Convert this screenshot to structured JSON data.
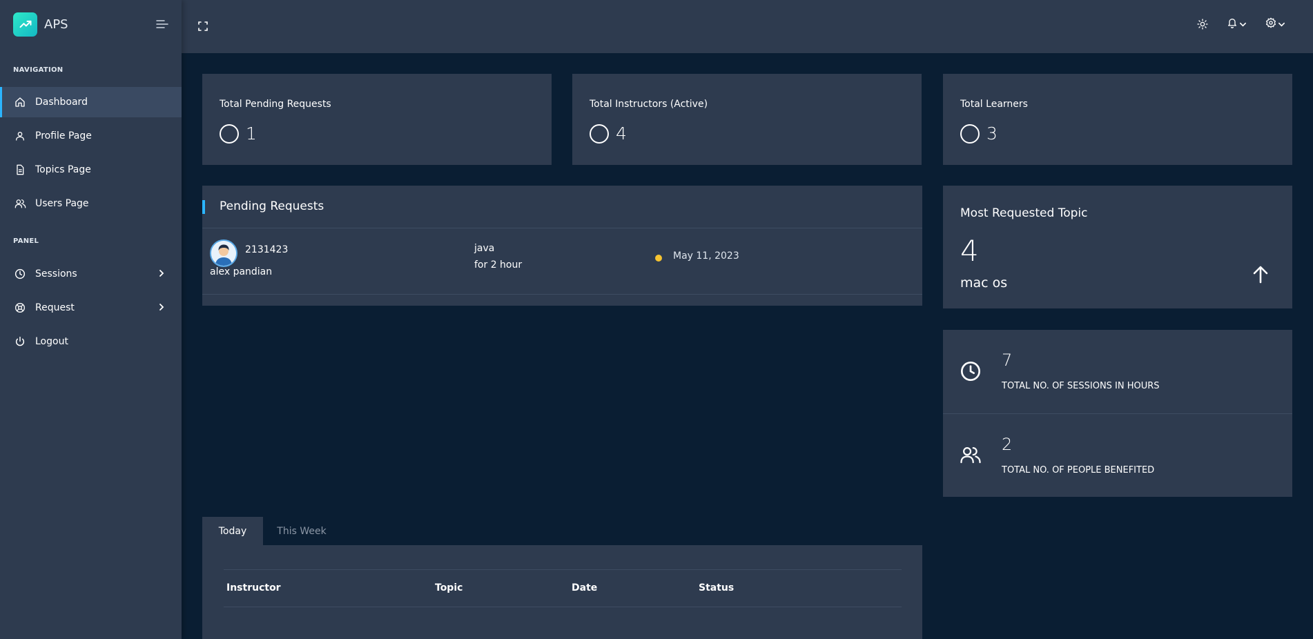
{
  "brand": {
    "name": "APS"
  },
  "sidebar": {
    "nav_heading": "NAVIGATION",
    "panel_heading": "PANEL",
    "nav_items": [
      {
        "label": "Dashboard",
        "icon": "home-icon"
      },
      {
        "label": "Profile Page",
        "icon": "user-icon"
      },
      {
        "label": "Topics Page",
        "icon": "document-icon"
      },
      {
        "label": "Users Page",
        "icon": "users-icon"
      }
    ],
    "panel_items": [
      {
        "label": "Sessions",
        "icon": "clock-icon"
      },
      {
        "label": "Request",
        "icon": "support-icon"
      },
      {
        "label": "Logout",
        "icon": "power-icon"
      }
    ]
  },
  "stats": [
    {
      "title": "Total Pending Requests",
      "value": "1"
    },
    {
      "title": "Total Instructors (Active)",
      "value": "4"
    },
    {
      "title": "Total Learners",
      "value": "3"
    }
  ],
  "pending": {
    "title": "Pending Requests",
    "requests": [
      {
        "id": "2131423",
        "name": "alex pandian",
        "topic": "java",
        "duration": "for 2 hour",
        "date": "May 11, 2023",
        "status_color": "#f5c331"
      }
    ]
  },
  "most_requested": {
    "title": "Most Requested Topic",
    "count": "4",
    "topic": "mac os"
  },
  "metrics": [
    {
      "value": "7",
      "label": "TOTAL NO. OF SESSIONS IN HOURS",
      "icon": "clock-icon"
    },
    {
      "value": "2",
      "label": "TOTAL NO. OF PEOPLE BENEFITED",
      "icon": "users-icon"
    }
  ],
  "tabs": [
    {
      "label": "Today",
      "active": true
    },
    {
      "label": "This Week",
      "active": false
    }
  ],
  "table": {
    "columns": [
      "Instructor",
      "Topic",
      "Date",
      "Status"
    ]
  },
  "colors": {
    "accent": "#2bb5ff",
    "brand": "#1fd1c8",
    "pending": "#f5c331",
    "sidebar": "#2e3b4f",
    "background": "#0a1e33"
  }
}
